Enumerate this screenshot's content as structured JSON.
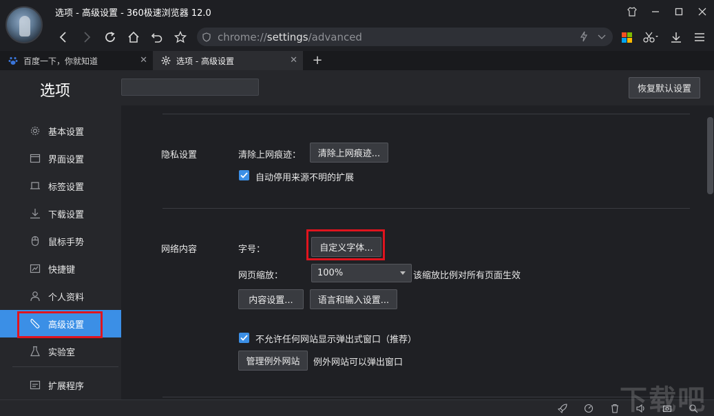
{
  "window": {
    "title": "选项 - 高级设置 - 360极速浏览器 12.0",
    "controls": [
      "shirt-icon",
      "minimize-icon",
      "maximize-icon",
      "close-icon"
    ]
  },
  "toolbar": {
    "address_prefix": "chrome://",
    "address_host": "settings",
    "address_path": "/advanced"
  },
  "tabs": [
    {
      "label": "百度一下，你就知道",
      "active": false
    },
    {
      "label": "选项 - 高级设置",
      "active": true
    }
  ],
  "settings": {
    "title": "选项",
    "search_value": "",
    "restore_label": "恢复默认设置"
  },
  "sidebar": {
    "items": [
      {
        "label": "基本设置",
        "icon": "gear-icon"
      },
      {
        "label": "界面设置",
        "icon": "window-icon"
      },
      {
        "label": "标签设置",
        "icon": "tab-icon"
      },
      {
        "label": "下载设置",
        "icon": "download-icon"
      },
      {
        "label": "鼠标手势",
        "icon": "mouse-icon"
      },
      {
        "label": "快捷键",
        "icon": "keyboard-icon"
      },
      {
        "label": "个人资料",
        "icon": "person-icon"
      },
      {
        "label": "高级设置",
        "icon": "wrench-icon",
        "active": true
      },
      {
        "label": "实验室",
        "icon": "flask-icon"
      },
      {
        "label": "扩展程序",
        "icon": "extension-icon"
      }
    ]
  },
  "privacy": {
    "section_label": "隐私设置",
    "clear_label": "清除上网痕迹：",
    "clear_button": "清除上网痕迹...",
    "auto_disable_label": "自动停用来源不明的扩展",
    "auto_disable_checked": true
  },
  "web_content": {
    "section_label": "网络内容",
    "font_label": "字号：",
    "font_button": "自定义字体...",
    "zoom_label": "网页缩放：",
    "zoom_value": "100%",
    "zoom_note": "该缩放比例对所有页面生效",
    "content_settings_button": "内容设置...",
    "lang_button": "语言和输入设置...",
    "popup_label": "不允许任何网站显示弹出式窗口（推荐）",
    "popup_checked": true,
    "manage_exceptions_button": "管理例外网站",
    "exceptions_note": "例外网站可以弹出窗口"
  },
  "colors": {
    "accent": "#3b8fe6",
    "highlight_box": "#e0141e"
  }
}
